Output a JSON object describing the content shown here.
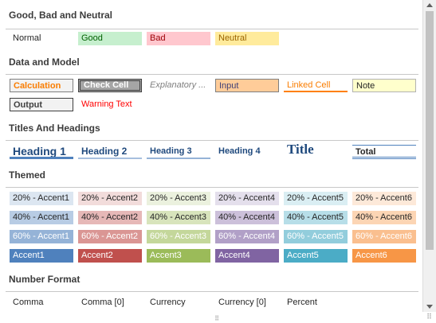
{
  "sections": {
    "good_bad_neutral": "Good, Bad and Neutral",
    "data_model": "Data and Model",
    "titles_headings": "Titles And Headings",
    "themed": "Themed",
    "number_format": "Number Format"
  },
  "good_bad": {
    "normal": "Normal",
    "good": "Good",
    "bad": "Bad",
    "neutral": "Neutral"
  },
  "data_model": {
    "calculation": "Calculation",
    "check_cell": "Check Cell",
    "explanatory": "Explanatory ...",
    "input": "Input",
    "linked_cell": "Linked Cell",
    "note": "Note",
    "output": "Output",
    "warning": "Warning Text"
  },
  "titles": {
    "h1": "Heading 1",
    "h2": "Heading 2",
    "h3": "Heading 3",
    "h4": "Heading 4",
    "title": "Title",
    "total": "Total"
  },
  "themed": {
    "row20": [
      "20% - Accent1",
      "20% - Accent2",
      "20% - Accent3",
      "20% - Accent4",
      "20% - Accent5",
      "20% - Accent6"
    ],
    "row40": [
      "40% - Accent1",
      "40% - Accent2",
      "40% - Accent3",
      "40% - Accent4",
      "40% - Accent5",
      "40% - Accent6"
    ],
    "row60": [
      "60% - Accent1",
      "60% - Accent2",
      "60% - Accent3",
      "60% - Accent4",
      "60% - Accent5",
      "60% - Accent6"
    ],
    "accent": [
      "Accent1",
      "Accent2",
      "Accent3",
      "Accent4",
      "Accent5",
      "Accent6"
    ]
  },
  "number_format": {
    "comma": "Comma",
    "comma0": "Comma [0]",
    "currency": "Currency",
    "currency0": "Currency [0]",
    "percent": "Percent"
  },
  "colors": {
    "accent1": "#4f81bd",
    "accent2": "#c0504d",
    "accent3": "#9bbb59",
    "accent4": "#8064a2",
    "accent5": "#4bacc6",
    "accent6": "#f79646",
    "good_bg": "#c6efce",
    "good_fg": "#006100",
    "bad_bg": "#ffc7ce",
    "bad_fg": "#9c0006",
    "neutral_bg": "#ffeb9c",
    "neutral_fg": "#9c6500"
  }
}
